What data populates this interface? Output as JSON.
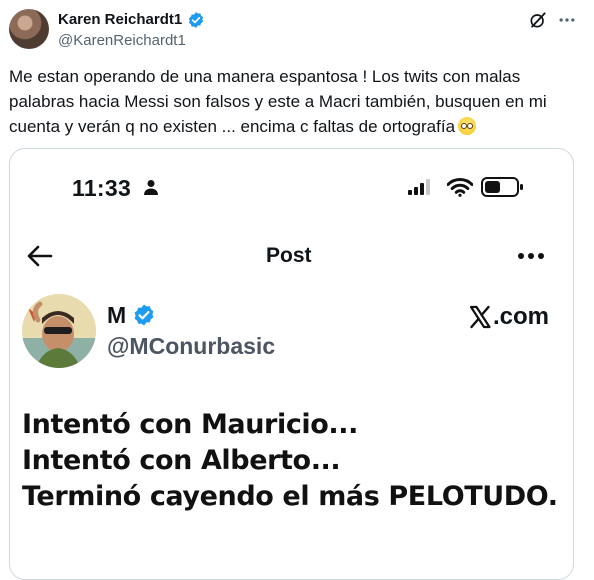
{
  "tweet": {
    "author_name": "Karen Reichardt1",
    "author_handle": "@KarenReichardt1",
    "text": "Me estan operando de una manera espantosa ! Los twits con malas palabras hacia Messi  son falsos y este a Macri también, busquen en mi cuenta y verán q no existen ... encima c faltas de ortografía"
  },
  "screenshot": {
    "status_time": "11:33",
    "nav_title": "Post",
    "author_name": "M",
    "author_handle": "@MConurbasic",
    "source_label": ".com",
    "lines": [
      "Intentó con Mauricio...",
      "Intentó con Alberto...",
      "Terminó cayendo el más PELOTUDO."
    ]
  },
  "colors": {
    "verified_blue": "#1d9bf0",
    "text_primary": "#0f1419",
    "text_secondary": "#536471",
    "border": "#cfd9de"
  },
  "icons": {
    "verified": "verified-badge-icon",
    "grok": "grok-icon",
    "more": "more-horizontal-icon",
    "back": "back-arrow-icon",
    "x_logo": "x-logo-icon",
    "emoji": "face-with-rolling-eyes-icon"
  }
}
